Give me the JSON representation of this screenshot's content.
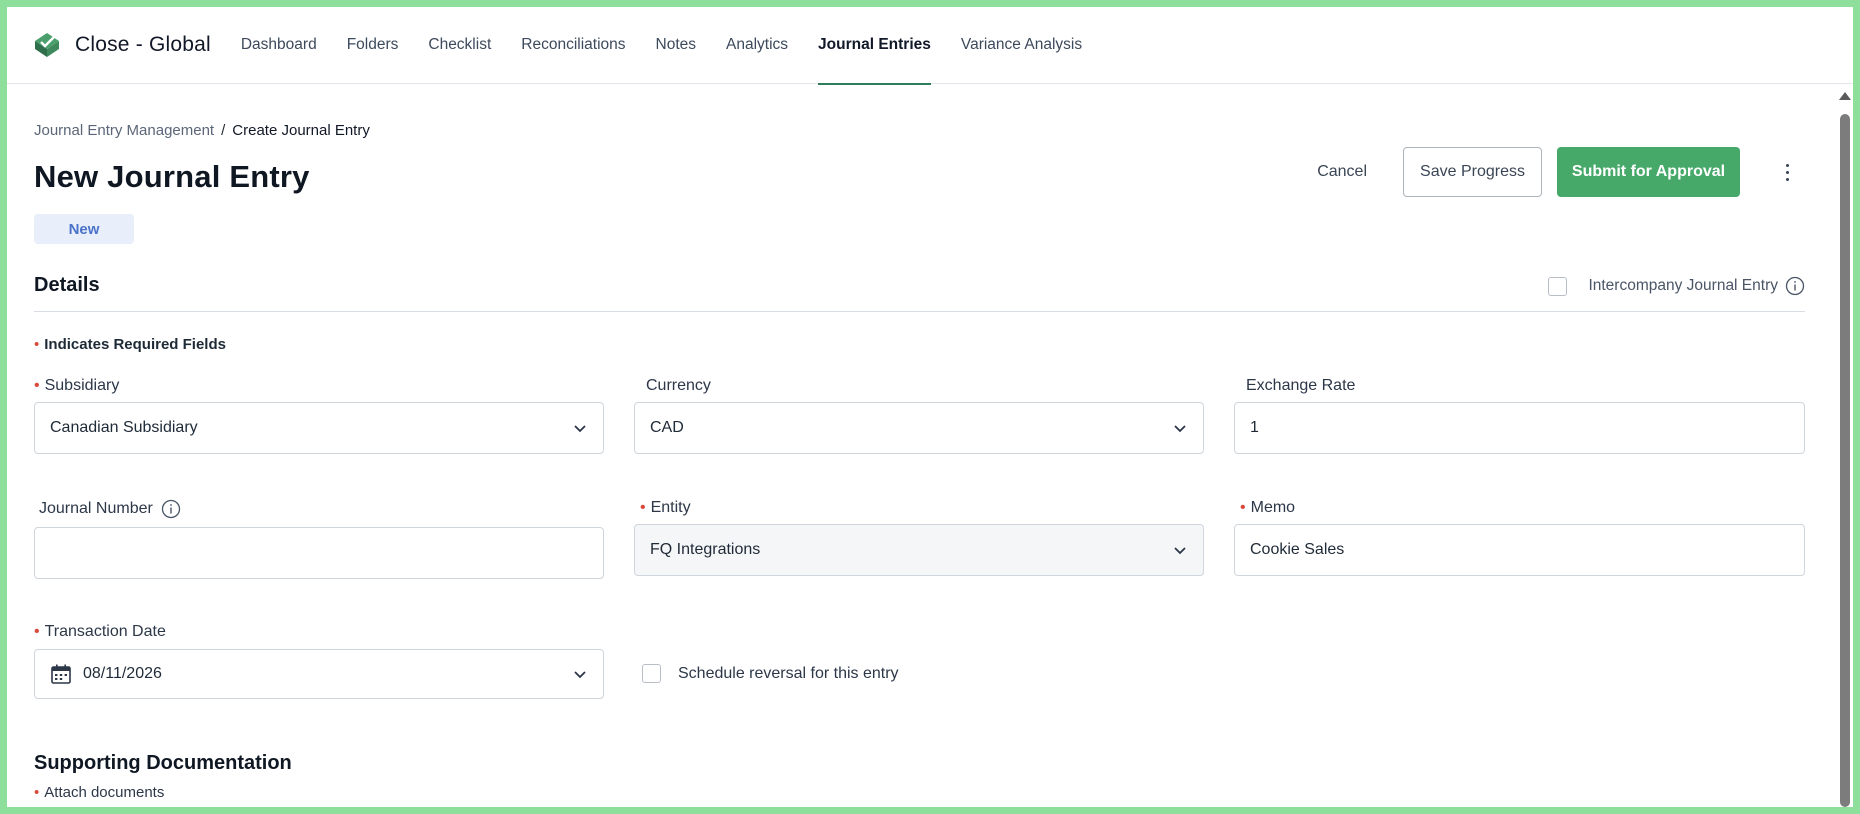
{
  "app": {
    "name": "Close - Global"
  },
  "nav": {
    "items": [
      {
        "label": "Dashboard",
        "active": false
      },
      {
        "label": "Folders",
        "active": false
      },
      {
        "label": "Checklist",
        "active": false
      },
      {
        "label": "Reconciliations",
        "active": false
      },
      {
        "label": "Notes",
        "active": false
      },
      {
        "label": "Analytics",
        "active": false
      },
      {
        "label": "Journal Entries",
        "active": true
      },
      {
        "label": "Variance Analysis",
        "active": false
      }
    ]
  },
  "breadcrumb": {
    "parent": "Journal Entry Management",
    "separator": "/",
    "current": "Create Journal Entry"
  },
  "page": {
    "title": "New Journal Entry",
    "status": "New"
  },
  "actions": {
    "cancel": "Cancel",
    "save": "Save Progress",
    "submit": "Submit for Approval"
  },
  "details": {
    "title": "Details",
    "intercompany_label": "Intercompany Journal Entry",
    "required_note": "Indicates Required Fields",
    "fields": {
      "subsidiary": {
        "label": "Subsidiary",
        "value": "Canadian Subsidiary"
      },
      "currency": {
        "label": "Currency",
        "value": "CAD"
      },
      "exchange_rate": {
        "label": "Exchange Rate",
        "value": "1"
      },
      "journal_number": {
        "label": "Journal Number",
        "value": ""
      },
      "entity": {
        "label": "Entity",
        "value": "FQ Integrations"
      },
      "memo": {
        "label": "Memo",
        "value": "Cookie Sales"
      },
      "transaction_date": {
        "label": "Transaction Date",
        "value": "08/11/2026"
      }
    },
    "schedule_reversal_label": "Schedule reversal for this entry"
  },
  "supporting": {
    "title": "Supporting Documentation",
    "attach_label": "Attach documents"
  },
  "colors": {
    "accent": "#46a96a",
    "nav_underline": "#2e7d5b",
    "required": "#d84a3b",
    "badge_bg": "#e8effb",
    "badge_text": "#4a72c9"
  }
}
